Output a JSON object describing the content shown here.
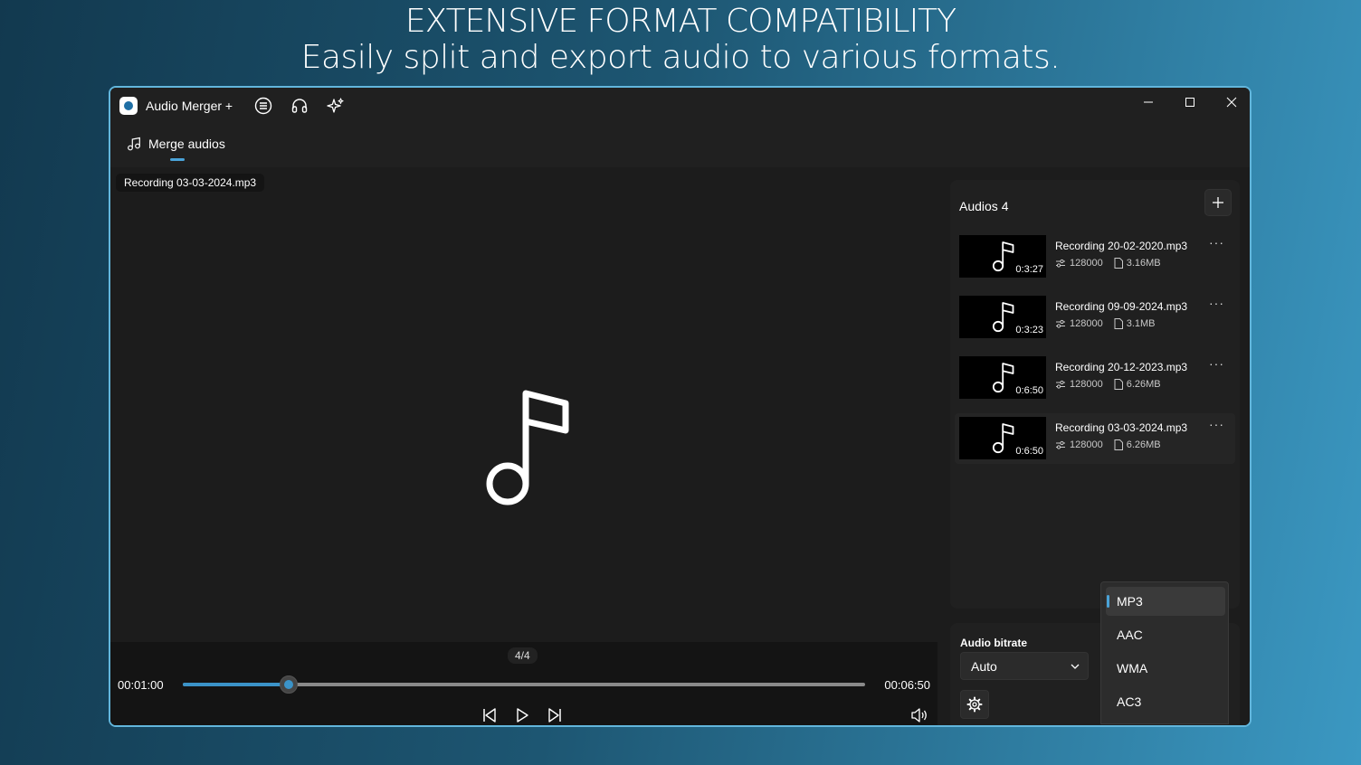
{
  "headline": {
    "title": "EXTENSIVE FORMAT COMPATIBILITY",
    "subtitle": "Easily split and export audio to various formats."
  },
  "app": {
    "title": "Audio Merger +",
    "accent_color": "#4aa3d8",
    "titlebar_icons": [
      "menu-circle-icon",
      "headphones-icon",
      "sparkle-icon"
    ]
  },
  "nav": {
    "merge_label": "Merge audios"
  },
  "player": {
    "file_name": "Recording 03-03-2024.mp3",
    "counter": "4/4",
    "current_time": "00:01:00",
    "total_time": "00:06:50",
    "progress": 0.1548
  },
  "audios": {
    "title": "Audios 4",
    "items": [
      {
        "name": "Recording 20-02-2020.mp3",
        "duration": "0:3:27",
        "bitrate": "128000",
        "size": "3.16MB",
        "more": "···"
      },
      {
        "name": "Recording 09-09-2024.mp3",
        "duration": "0:3:23",
        "bitrate": "128000",
        "size": "3.1MB",
        "more": "···"
      },
      {
        "name": "Recording 20-12-2023.mp3",
        "duration": "0:6:50",
        "bitrate": "128000",
        "size": "6.26MB",
        "more": "···"
      },
      {
        "name": "Recording 03-03-2024.mp3",
        "duration": "0:6:50",
        "bitrate": "128000",
        "size": "6.26MB",
        "more": "···"
      }
    ]
  },
  "settings": {
    "bitrate_label": "Audio bitrate",
    "bitrate_value": "Auto"
  },
  "formats": {
    "selected": "MP3",
    "options": [
      "MP3",
      "AAC",
      "WMA",
      "AC3"
    ]
  }
}
